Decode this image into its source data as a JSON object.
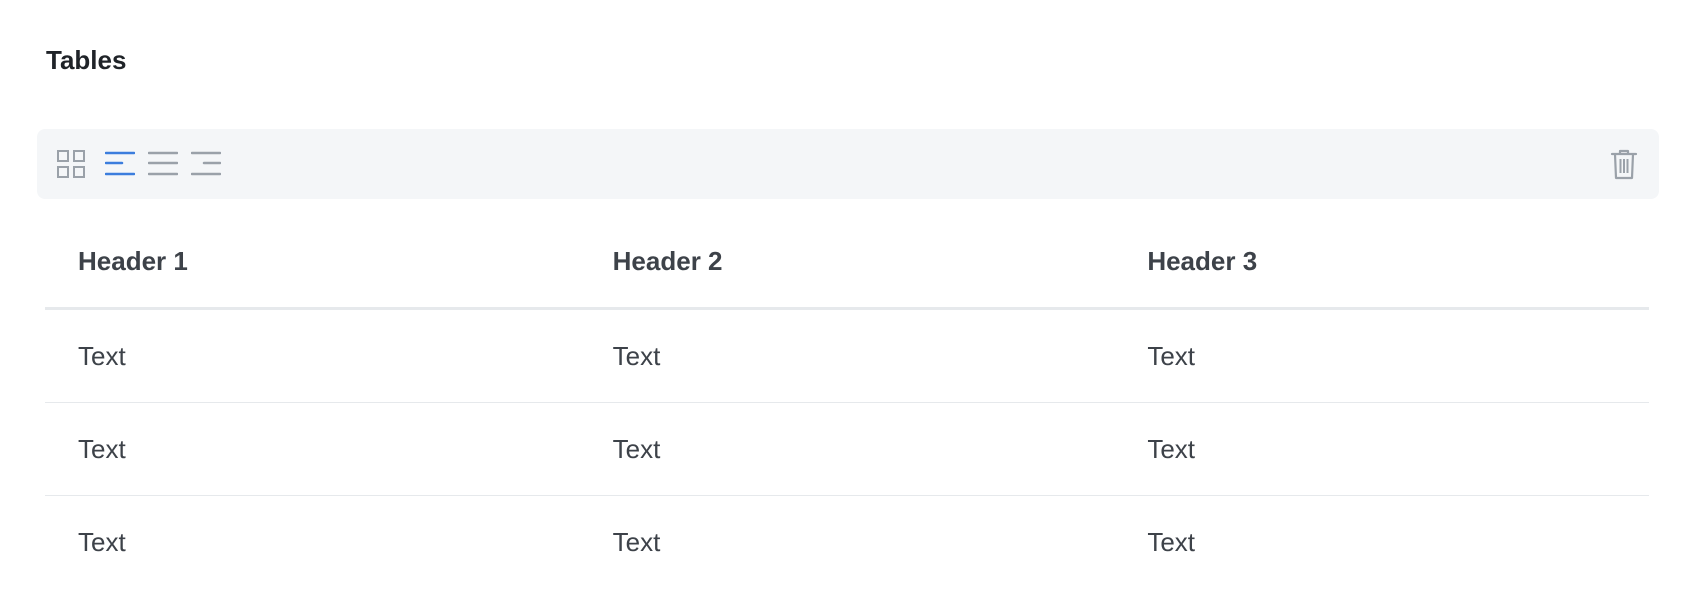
{
  "section": {
    "title": "Tables"
  },
  "toolbar": {
    "buttons": [
      {
        "name": "grid-layout",
        "icon": "grid-icon",
        "active": false
      },
      {
        "name": "align-left",
        "icon": "align-left-icon",
        "active": true
      },
      {
        "name": "align-center",
        "icon": "align-justify-icon",
        "active": false
      },
      {
        "name": "align-right",
        "icon": "align-right-icon",
        "active": false
      },
      {
        "name": "delete",
        "icon": "trash-icon",
        "active": false
      }
    ],
    "colors": {
      "active": "#3b7ddd",
      "inactive": "#9aa1a9",
      "background": "#f4f6f8"
    }
  },
  "table": {
    "headers": [
      "Header 1",
      "Header 2",
      "Header 3"
    ],
    "rows": [
      [
        "Text",
        "Text",
        "Text"
      ],
      [
        "Text",
        "Text",
        "Text"
      ],
      [
        "Text",
        "Text",
        "Text"
      ]
    ]
  }
}
